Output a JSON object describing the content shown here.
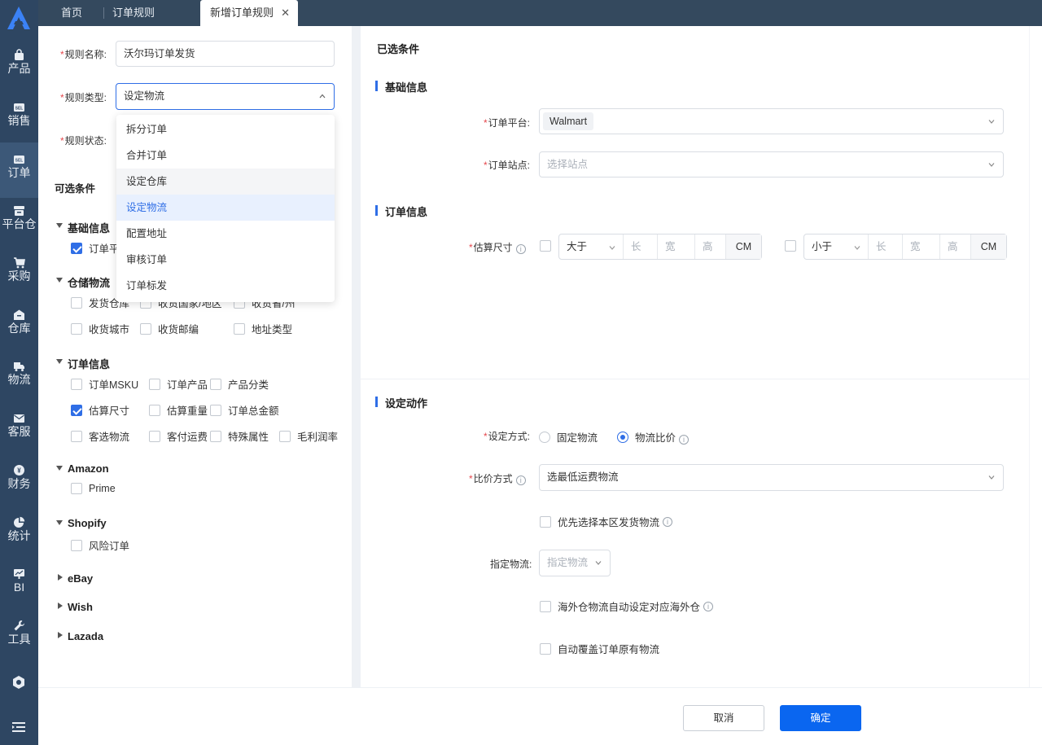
{
  "tabs": [
    {
      "label": "首页"
    },
    {
      "label": "订单规则"
    },
    {
      "label": "新增订单规则"
    }
  ],
  "nav": [
    {
      "label": "产品",
      "icon": "product-bag-icon"
    },
    {
      "label": "销售",
      "icon": "sales-sel-icon"
    },
    {
      "label": "订单",
      "icon": "order-sel-icon"
    },
    {
      "label": "平台仓",
      "icon": "platform-warehouse-icon"
    },
    {
      "label": "采购",
      "icon": "cart-icon"
    },
    {
      "label": "仓库",
      "icon": "warehouse-icon"
    },
    {
      "label": "物流",
      "icon": "truck-icon"
    },
    {
      "label": "客服",
      "icon": "mail-icon"
    },
    {
      "label": "财务",
      "icon": "yen-icon"
    },
    {
      "label": "统计",
      "icon": "pie-chart-icon"
    },
    {
      "label": "BI",
      "icon": "bi-chart-icon"
    },
    {
      "label": "工具",
      "icon": "wrench-icon"
    }
  ],
  "nav_active": "订单",
  "form": {
    "name_label": "规则名称:",
    "name_value": "沃尔玛订单发货",
    "type_label": "规则类型:",
    "type_value": "设定物流",
    "status_label": "规则状态:"
  },
  "type_options": [
    "拆分订单",
    "合并订单",
    "设定仓库",
    "设定物流",
    "配置地址",
    "审核订单",
    "订单标发"
  ],
  "optional": {
    "title": "可选条件",
    "groups": [
      {
        "title": "基础信息",
        "expanded": true,
        "items": [
          {
            "label": "订单平台",
            "checked": true
          }
        ]
      },
      {
        "title": "仓储物流",
        "expanded": true,
        "items": [
          {
            "label": "发货仓库",
            "checked": false
          },
          {
            "label": "收货国家/地区",
            "checked": false
          },
          {
            "label": "收货省/州",
            "checked": false
          },
          {
            "label": "收货城市",
            "checked": false
          },
          {
            "label": "收货邮编",
            "checked": false
          },
          {
            "label": "地址类型",
            "checked": false
          }
        ]
      },
      {
        "title": "订单信息",
        "expanded": true,
        "items": [
          {
            "label": "订单MSKU",
            "checked": false
          },
          {
            "label": "订单产品",
            "checked": false
          },
          {
            "label": "产品分类",
            "checked": false
          },
          {
            "label": "估算尺寸",
            "checked": true
          },
          {
            "label": "估算重量",
            "checked": false
          },
          {
            "label": "订单总金额",
            "checked": false
          },
          {
            "label": "客选物流",
            "checked": false
          },
          {
            "label": "客付运费",
            "checked": false
          },
          {
            "label": "特殊属性",
            "checked": false
          },
          {
            "label": "毛利润率",
            "checked": false
          }
        ]
      },
      {
        "title": "Amazon",
        "expanded": true,
        "items": [
          {
            "label": "Prime",
            "checked": false
          }
        ]
      },
      {
        "title": "Shopify",
        "expanded": true,
        "items": [
          {
            "label": "风险订单",
            "checked": false
          }
        ]
      },
      {
        "title": "eBay",
        "expanded": false,
        "items": []
      },
      {
        "title": "Wish",
        "expanded": false,
        "items": []
      },
      {
        "title": "Lazada",
        "expanded": false,
        "items": []
      }
    ]
  },
  "selected": {
    "title": "已选条件",
    "basic_title": "基础信息",
    "platform_label": "订单平台:",
    "platform_value": "Walmart",
    "site_label": "订单站点:",
    "site_placeholder": "选择站点",
    "order_title": "订单信息",
    "size_label": "估算尺寸",
    "size1": {
      "op": "大于",
      "l": "长",
      "w": "宽",
      "h": "高",
      "unit": "CM"
    },
    "size2": {
      "op": "小于",
      "l": "长",
      "w": "宽",
      "h": "高",
      "unit": "CM"
    }
  },
  "action": {
    "title": "设定动作",
    "method_label": "设定方式:",
    "method_options": [
      {
        "label": "固定物流",
        "selected": false
      },
      {
        "label": "物流比价",
        "selected": true
      }
    ],
    "compare_label": "比价方式",
    "compare_value": "选最低运费物流",
    "prefer_local": "优先选择本区发货物流",
    "assign_label": "指定物流:",
    "assign_placeholder": "指定物流",
    "overseas": "海外仓物流自动设定对应海外仓",
    "override": "自动覆盖订单原有物流"
  },
  "footer": {
    "cancel": "取消",
    "confirm": "确定"
  },
  "colors": {
    "nav_bg": "#2e4662",
    "accent": "#2f6ee6",
    "required": "#e5484d"
  }
}
